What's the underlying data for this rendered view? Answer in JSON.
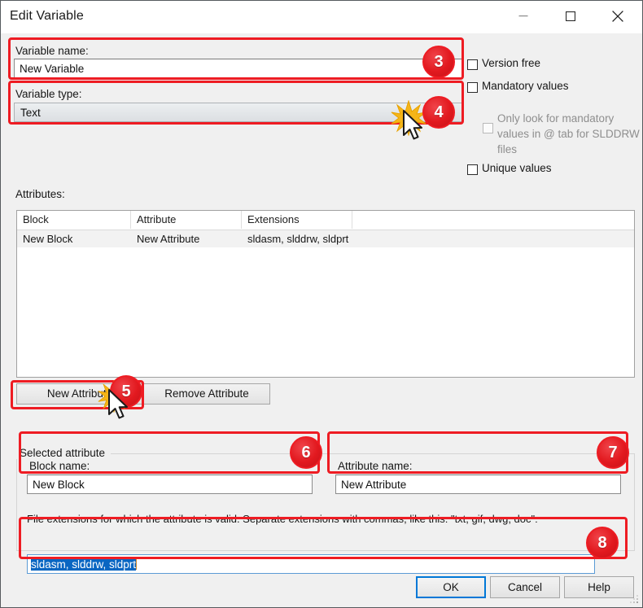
{
  "window": {
    "title": "Edit Variable",
    "minimize_icon": "minimize-icon",
    "maximize_icon": "maximize-icon",
    "close_icon": "close-icon"
  },
  "variable": {
    "name_label": "Variable name:",
    "name_value": "New Variable",
    "type_label": "Variable type:",
    "type_value": "Text"
  },
  "options": {
    "version_free": "Version free",
    "mandatory_values": "Mandatory values",
    "only_look_mandatory": "Only look for mandatory values in @ tab for SLDDRW files",
    "unique_values": "Unique values"
  },
  "attributes": {
    "label": "Attributes:",
    "columns": [
      "Block",
      "Attribute",
      "Extensions"
    ],
    "rows": [
      {
        "block": "New Block",
        "attribute": "New Attribute",
        "extensions": "sldasm, slddrw, sldprt"
      }
    ]
  },
  "buttons": {
    "new_attribute": "New Attribute",
    "remove_attribute": "Remove Attribute",
    "ok": "OK",
    "cancel": "Cancel",
    "help": "Help"
  },
  "selected_attribute": {
    "group_title": "Selected attribute",
    "block_name_label": "Block name:",
    "block_name_value": "New Block",
    "attribute_name_label": "Attribute name:",
    "attribute_name_value": "New Attribute"
  },
  "extensions": {
    "hint": "File extensions for which the attribute is valid. Separate extensions with commas, like this: \"txt, gif, dwg, doc\":",
    "value": "sldasm, slddrw, sldprt"
  },
  "annotations": {
    "badge3": "3",
    "badge4": "4",
    "badge5": "5",
    "badge6": "6",
    "badge7": "7",
    "badge8": "8",
    "accent_color": "#ee1c23"
  }
}
